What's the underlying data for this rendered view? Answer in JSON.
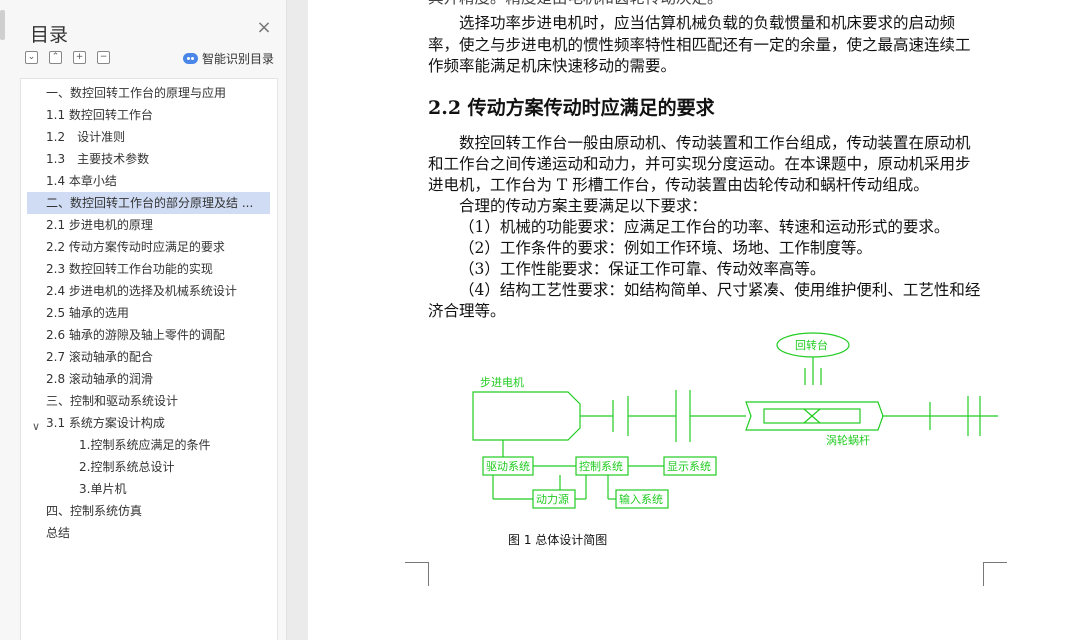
{
  "toc": {
    "title": "目录",
    "smart_toc_label": "智能识别目录",
    "items": [
      {
        "label": "一、数控回转工作台的原理与应用"
      },
      {
        "label": "1.1 数控回转工作台"
      },
      {
        "label": "1.2　设计准则"
      },
      {
        "label": "1.3　主要技术参数"
      },
      {
        "label": "1.4 本章小结"
      },
      {
        "label": "二、数控回转工作台的部分原理及结 ..."
      },
      {
        "label": "2.1 步进电机的原理"
      },
      {
        "label": "2.2 传动方案传动时应满足的要求"
      },
      {
        "label": "2.3 数控回转工作台功能的实现"
      },
      {
        "label": "2.4 步进电机的选择及机械系统设计"
      },
      {
        "label": "2.5 轴承的选用"
      },
      {
        "label": "2.6 轴承的游隙及轴上零件的调配"
      },
      {
        "label": "2.7 滚动轴承的配合"
      },
      {
        "label": "2.8 滚动轴承的润滑"
      },
      {
        "label": "三、控制和驱动系统设计"
      },
      {
        "label": "3.1 系统方案设计构成"
      },
      {
        "label": "1.控制系统应满足的条件"
      },
      {
        "label": "2.控制系统总设计"
      },
      {
        "label": "3.单片机"
      },
      {
        "label": "四、控制系统仿真"
      },
      {
        "label": "总结"
      }
    ]
  },
  "document": {
    "top_partial": "具开精度。精度是由电机和齿轮传动决定。",
    "para1": [
      "选择功率步进电机时，应当估算机械负载的负载惯量和机床要求的启动频",
      "率，使之与步进电机的惯性频率特性相匹配还有一定的余量，使之最高速连续工",
      "作频率能满足机床快速移动的需要。"
    ],
    "heading": "2.2  传动方案传动时应满足的要求",
    "para2": [
      "数控回转工作台一般由原动机、传动装置和工作台组成，传动装置在原动机",
      "和工作台之间传递运动和动力，并可实现分度运动。在本课题中，原动机采用步",
      "进电机，工作台为 T 形槽工作台，传动装置由齿轮传动和蜗杆传动组成。"
    ],
    "para3": "合理的传动方案主要满足以下要求：",
    "reqs": [
      "（1）机械的功能要求：应满足工作台的功率、转速和运动形式的要求。",
      "（2）工作条件的要求：例如工作环境、场地、工作制度等。",
      "（3）工作性能要求：保证工作可靠、传动效率高等。",
      "（4）结构工艺性要求：如结构简单、尺寸紧凑、使用维护便利、工艺性和经"
    ],
    "req4_cont": "济合理等。",
    "diagram_labels": {
      "table": "回转台",
      "motor": "步进电机",
      "worm": "涡轮蜗杆",
      "drive": "驱动系统",
      "control": "控制系统",
      "display": "显示系统",
      "power": "动力源",
      "input": "输入系统"
    },
    "figure_caption": "图 1 总体设计简图",
    "colors": {
      "diagram": "#22cc22",
      "selection": "#cfdcf4"
    }
  }
}
